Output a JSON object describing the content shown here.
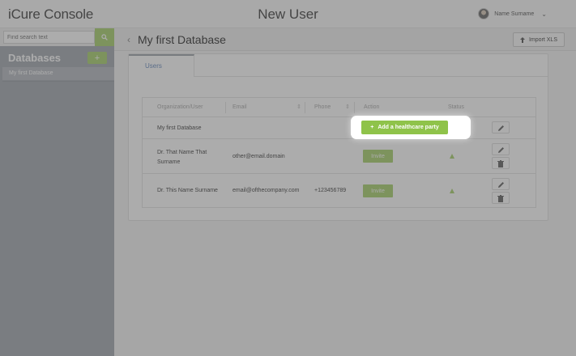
{
  "app": {
    "brand": "iCure Console",
    "page_title": "New User"
  },
  "user": {
    "name": "Name Surname"
  },
  "sidebar": {
    "search_placeholder": "Find search text",
    "databases_title": "Databases",
    "add_label": "+",
    "items": [
      {
        "label": "My first Database"
      }
    ]
  },
  "main": {
    "db_title": "My first Database",
    "import_label": "Import XLS",
    "tabs": [
      {
        "label": "Users"
      }
    ]
  },
  "table": {
    "columns": [
      "Organization/User",
      "Email",
      "Phone",
      "Action",
      "Status"
    ],
    "rows": [
      {
        "org": "My first Database",
        "email": "",
        "phone": "",
        "action": "+ Add a healthcare party",
        "status": ""
      },
      {
        "org": "Dr. That Name That Surname",
        "email": "other@email.domain",
        "phone": "",
        "action": "Invite",
        "status": "pending"
      },
      {
        "org": "Dr. This Name Surname",
        "email": "email@ofthecompany.com",
        "phone": "+123456789",
        "action": "Invite",
        "status": "pending"
      }
    ]
  },
  "highlight": {
    "label": "Add a healthcare party",
    "plus": "+"
  },
  "colors": {
    "accent": "#a9d16f",
    "sidebar": "#a5aab1",
    "link": "#6a8cbf"
  }
}
